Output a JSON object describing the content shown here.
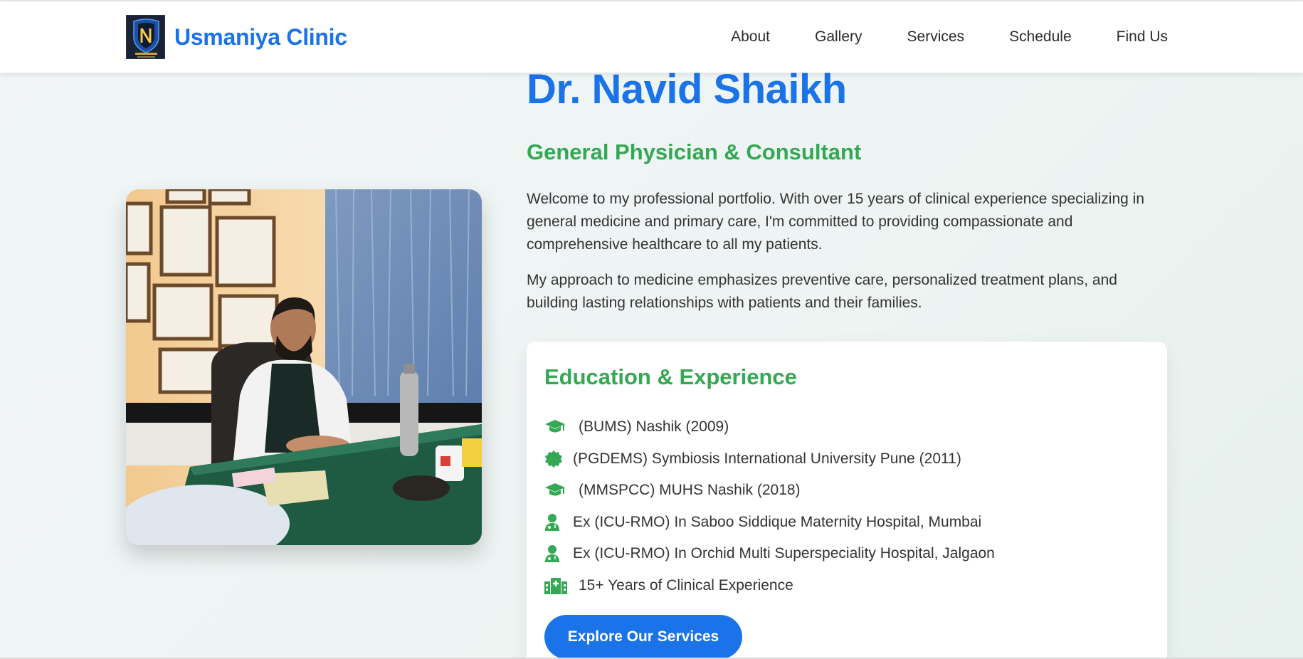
{
  "brand": {
    "name": "Usmaniya Clinic",
    "logo_icon": "clinic-shield-logo"
  },
  "nav": {
    "links": [
      "About",
      "Gallery",
      "Services",
      "Schedule",
      "Find Us"
    ]
  },
  "hero": {
    "name": "Dr. Navid Shaikh",
    "title": "General Physician & Consultant",
    "paragraphs": [
      "Welcome to my professional portfolio. With over 15 years of clinical experience specializing in general medicine and primary care, I'm committed to providing compassionate and comprehensive healthcare to all my patients.",
      "My approach to medicine emphasizes preventive care, personalized treatment plans, and building lasting relationships with patients and their families."
    ]
  },
  "education": {
    "title": "Education & Experience",
    "items": [
      {
        "icon": "graduation-cap-icon",
        "text": "(BUMS) Nashik (2009)"
      },
      {
        "icon": "certificate-icon",
        "text": "(PGDEMS) Symbiosis International University Pune (2011)"
      },
      {
        "icon": "graduation-cap-icon",
        "text": "(MMSPCC) MUHS Nashik (2018)"
      },
      {
        "icon": "user-doctor-icon",
        "text": "Ex (ICU-RMO) In Saboo Siddique Maternity Hospital, Mumbai"
      },
      {
        "icon": "user-doctor-icon",
        "text": "Ex (ICU-RMO) In Orchid Multi Superspeciality Hospital, Jalgaon"
      },
      {
        "icon": "hospital-icon",
        "text": "15+ Years of Clinical Experience"
      }
    ],
    "cta_label": "Explore Our Services"
  },
  "colors": {
    "primary": "#1a73e8",
    "accent": "#34a853",
    "text": "#333333"
  }
}
